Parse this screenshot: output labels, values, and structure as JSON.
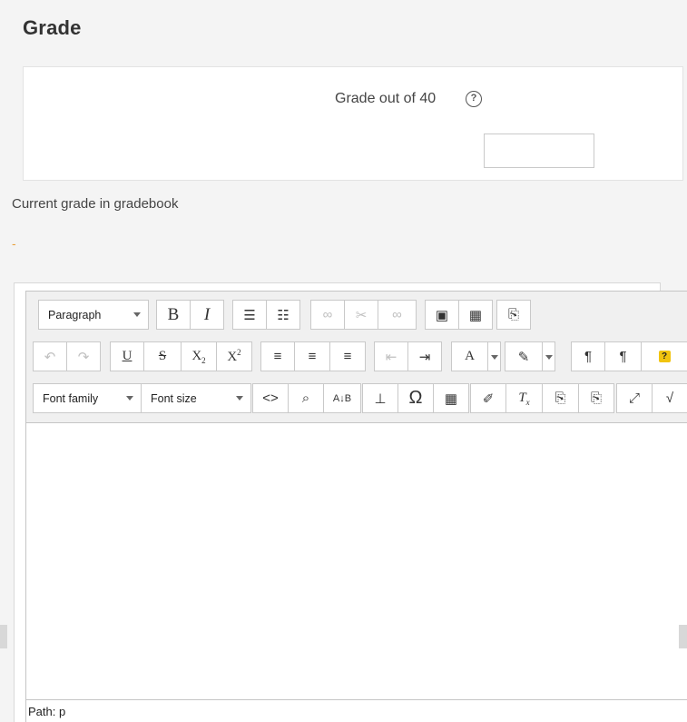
{
  "section": {
    "heading": "Grade"
  },
  "grade": {
    "label": "Grade out of 40",
    "help_icon": "question-circle-icon",
    "input_value": "",
    "current_label": "Current grade in gradebook",
    "current_value": "-"
  },
  "editor": {
    "row1": {
      "block_format": "Paragraph",
      "bold": "B",
      "italic": "I"
    },
    "row3": {
      "font_family": "Font family",
      "font_size": "Font size"
    },
    "status": "Path: p",
    "icons": {
      "undo": "undo-icon",
      "redo": "redo-icon",
      "bullets": "bullet-list-icon",
      "numbers": "numbered-list-icon",
      "link": "link-icon",
      "unlink": "unlink-icon",
      "anchor": "anchor-icon",
      "image": "image-icon",
      "media": "media-icon",
      "paste": "paste-icon",
      "underline": "underline-icon",
      "strike": "strikethrough-icon",
      "subscript": "subscript-icon",
      "superscript": "superscript-icon",
      "align_left": "align-left-icon",
      "align_center": "align-center-icon",
      "align_right": "align-right-icon",
      "outdent": "outdent-icon",
      "indent": "indent-icon",
      "text_color": "text-color-icon",
      "bg_color": "background-color-icon",
      "ltr": "ltr-icon",
      "rtl": "rtl-icon",
      "help": "help-icon",
      "code": "code-icon",
      "search": "search-replace-icon",
      "spellcheck": "spellcheck-icon",
      "anchor_insert": "insert-anchor-icon",
      "charmap": "special-character-icon",
      "table": "table-icon",
      "cleanup": "cleanup-icon",
      "clear_format": "clear-formatting-icon",
      "paste_text": "paste-text-icon",
      "paste_word": "paste-word-icon",
      "fullscreen": "fullscreen-icon",
      "equation": "equation-icon"
    }
  }
}
